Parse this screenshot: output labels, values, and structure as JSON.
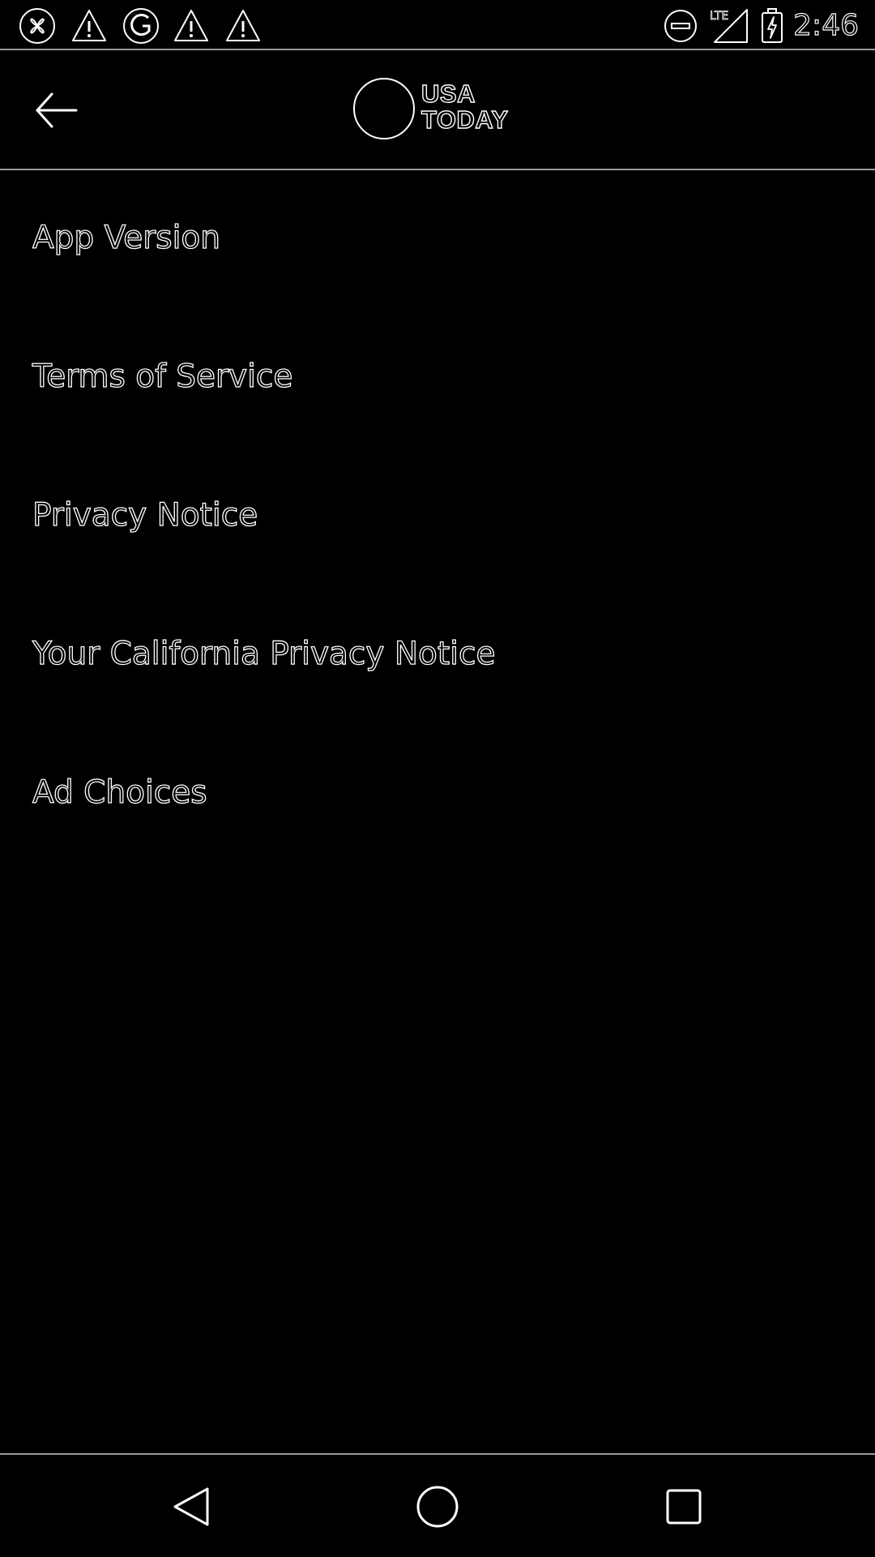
{
  "status_bar": {
    "time": "2:46",
    "network_label": "LTE",
    "left_icons": [
      "app-notification-icon",
      "warning-icon",
      "gannett-g-icon",
      "warning-icon",
      "warning-icon"
    ],
    "right_icons": [
      "do-not-disturb-icon",
      "lte-signal-icon",
      "battery-charging-icon"
    ]
  },
  "app_bar": {
    "logo_line1": "USA",
    "logo_line2": "TODAY",
    "back_icon": "arrow-back-icon"
  },
  "menu": {
    "items": [
      {
        "label": "App Version"
      },
      {
        "label": "Terms of Service"
      },
      {
        "label": "Privacy Notice"
      },
      {
        "label": "Your California Privacy Notice"
      },
      {
        "label": "Ad Choices"
      }
    ]
  },
  "nav_bar": {
    "icons": [
      "nav-back-icon",
      "nav-home-icon",
      "nav-recents-icon"
    ]
  },
  "colors": {
    "background": "#000000",
    "outline": "#ffffff",
    "divider": "#9a9a9a"
  }
}
